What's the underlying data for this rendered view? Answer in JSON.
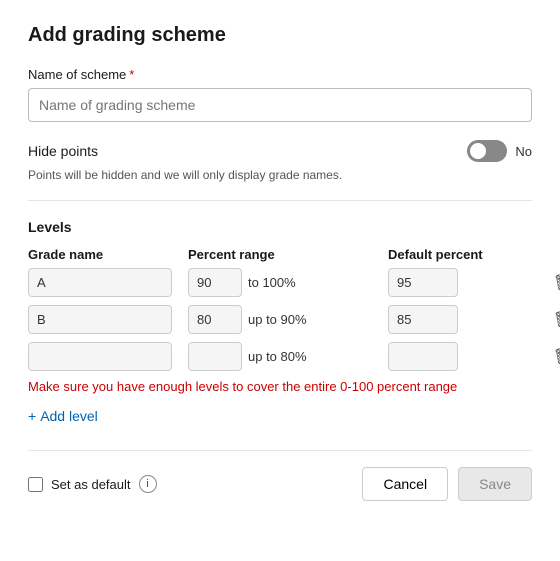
{
  "page": {
    "title": "Add grading scheme"
  },
  "name_field": {
    "label": "Name of scheme",
    "required_marker": "*",
    "placeholder": "Name of grading scheme"
  },
  "hide_points": {
    "label": "Hide points",
    "toggle_state": "off",
    "no_label": "No",
    "hint": "Points will be hidden and we will only display grade names."
  },
  "levels": {
    "heading": "Levels",
    "columns": {
      "grade": "Grade name",
      "percent": "Percent range",
      "default": "Default percent"
    },
    "rows": [
      {
        "grade": "A",
        "from": "90",
        "to_text": "to 100%",
        "default": "95"
      },
      {
        "grade": "B",
        "from": "80",
        "to_text": "up to 90%",
        "default": "85"
      },
      {
        "grade": "",
        "from": "",
        "to_text": "up to 80%",
        "default": ""
      }
    ],
    "error": "Make sure you have enough levels to cover the entire 0-100 percent range",
    "add_level_label": "Add level"
  },
  "footer": {
    "set_default_label": "Set as default",
    "cancel_label": "Cancel",
    "save_label": "Save"
  },
  "icons": {
    "trash": "🗑",
    "plus": "+",
    "info": "i"
  }
}
